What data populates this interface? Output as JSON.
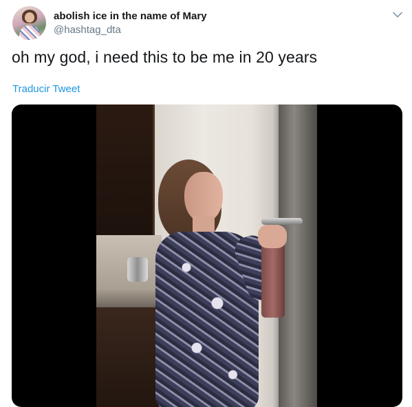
{
  "tweet": {
    "author_name": "abolish ice in the name of Mary",
    "author_handle": "@hashtag_dta",
    "text": "oh my god, i need this to be me in 20 years",
    "translate_label": "Traducir Tweet"
  },
  "icons": {
    "menu": "chevron-down-icon"
  },
  "colors": {
    "link": "#1b95e0",
    "secondary_text": "#657786",
    "primary_text": "#14171a"
  }
}
